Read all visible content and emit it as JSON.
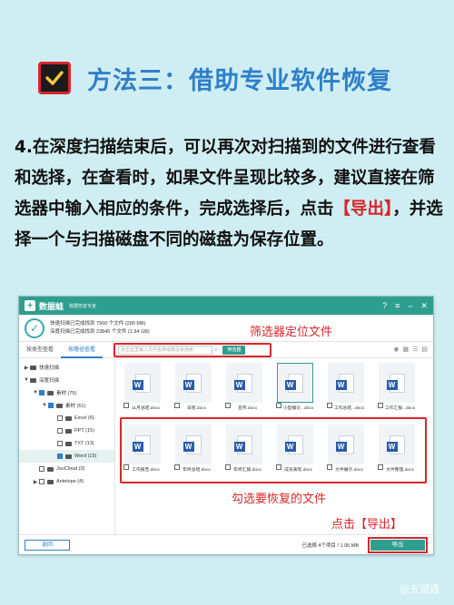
{
  "title": "方法三：借助专业软件恢复",
  "paragraph": {
    "before": "4.在深度扫描结束后，可以再次对扫描到的文件进行查看和选择，在查看时，如果文件呈现比较多，建议直接在筛选器中输入相应的条件，完成选择后，点击",
    "highlight": "【导出】",
    "after": "，并选择一个与扫描磁盘不同的磁盘为保存位置。"
  },
  "app": {
    "name": "数据蛙",
    "subtitle": "数据恢复专家",
    "summary_line1": "快速扫描已完成找到 7560 个文件 (289 MB)",
    "summary_line2": "深度扫描已完成找到 23845 个文件 (1.34 GB)",
    "tabs": [
      "按类型查看",
      "按路径查看"
    ],
    "filter_placeholder": "点击这里输入文件名称或路径来搜索",
    "filter_button": "筛选器",
    "tree": [
      {
        "label": "快速扫描",
        "indent": 0,
        "arrow": "▶"
      },
      {
        "label": "深度扫描",
        "indent": 0,
        "arrow": "▼"
      },
      {
        "label": "素材 (75)",
        "indent": 1,
        "arrow": "▼"
      },
      {
        "label": "素材 (61)",
        "indent": 2,
        "arrow": "▼"
      },
      {
        "label": "Excel (6)",
        "indent": 3,
        "arrow": ""
      },
      {
        "label": "PPT (15)",
        "indent": 3,
        "arrow": ""
      },
      {
        "label": "TXT (13)",
        "indent": 3,
        "arrow": ""
      },
      {
        "label": "Word (15)",
        "indent": 3,
        "arrow": ""
      },
      {
        "label": "JouCloud (0)",
        "indent": 1,
        "arrow": ""
      },
      {
        "label": "Antelope (4)",
        "indent": 1,
        "arrow": "▶"
      }
    ],
    "files_row1": [
      "11月总结.docx",
      "日程.docx",
      "宣传.docx",
      "小型镇论...docx",
      "工作总结...docx",
      "工作汇报...docx"
    ],
    "files_row2": [
      "工作报告.docx",
      "年终总结.docx",
      "年终汇报.docx",
      "成员表现.docx",
      "文件展示.docx",
      "文件整理.docx"
    ],
    "back_button": "返回",
    "selection_info": "已选择 4个项目 / 1.95 MB",
    "export_button": "导出"
  },
  "annotations": {
    "filter": "筛选器定位文件",
    "tick": "勾选要恢复的文件",
    "export": "点击【导出】"
  },
  "watermark": "@五湖遇"
}
